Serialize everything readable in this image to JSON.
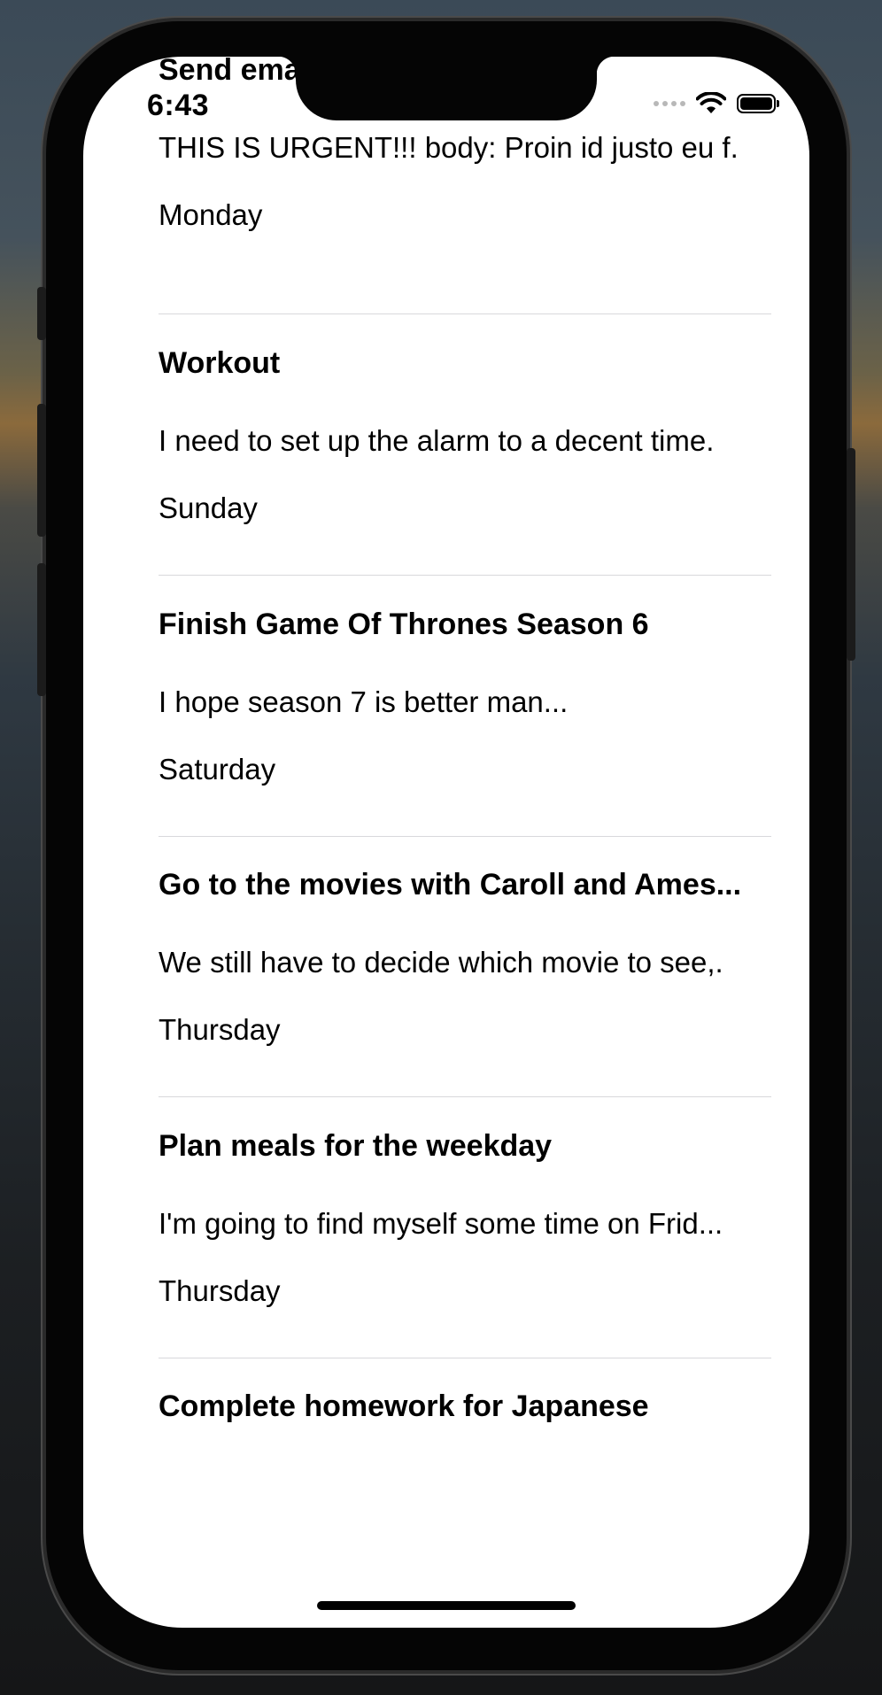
{
  "status_bar": {
    "time": "6:43",
    "icons": [
      "cellular-dots-icon",
      "wifi-icon",
      "battery-icon"
    ]
  },
  "tasks": [
    {
      "title": "Send email to manager",
      "body": "THIS IS URGENT!!! body: Proin id justo eu f.",
      "day": "Monday"
    },
    {
      "title": "Workout",
      "body": "I need to set up the alarm to a decent time.",
      "day": "Sunday"
    },
    {
      "title": "Finish Game Of Thrones Season 6",
      "body": "I hope season 7 is better man...",
      "day": "Saturday"
    },
    {
      "title": "Go to the movies with Caroll and Ames...",
      "body": "We still have to decide which movie to see,.",
      "day": "Thursday"
    },
    {
      "title": "Plan meals for the weekday",
      "body": "I'm going to find myself some time on Frid...",
      "day": "Thursday"
    },
    {
      "title": "Complete homework for Japanese",
      "body": "",
      "day": ""
    }
  ]
}
